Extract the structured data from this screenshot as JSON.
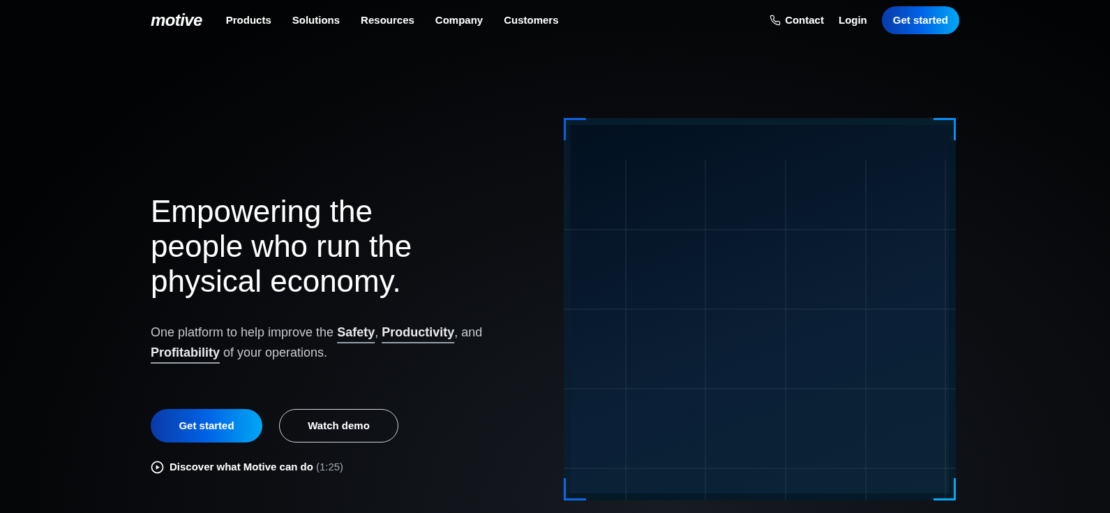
{
  "header": {
    "logo": "motive",
    "nav": [
      {
        "label": "Products"
      },
      {
        "label": "Solutions"
      },
      {
        "label": "Resources"
      },
      {
        "label": "Company"
      },
      {
        "label": "Customers"
      }
    ],
    "contact": "Contact",
    "login": "Login",
    "cta": "Get started"
  },
  "hero": {
    "headline": "Empowering the people who run the physical economy.",
    "subtitle": "One platform to help improve the **Safety**, **Productivity**, and **Profitability** of your operations.",
    "primary_button": "Get started",
    "secondary_button": "Watch demo",
    "video_link": {
      "label": "Discover what Motive can do",
      "duration": "(1:25)"
    }
  }
}
